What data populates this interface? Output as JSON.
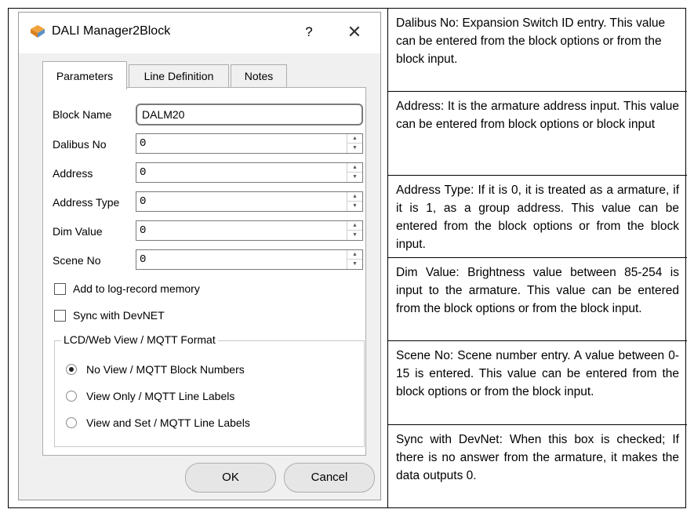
{
  "dialog": {
    "title": "DALI Manager2Block",
    "help_label": "?",
    "close_label": "✕",
    "tabs": [
      {
        "label": "Parameters"
      },
      {
        "label": "Line Definition"
      },
      {
        "label": "Notes"
      }
    ],
    "fields": [
      {
        "label": "Block Name",
        "value": "DALM20"
      },
      {
        "label": "Dalibus No",
        "value": "0"
      },
      {
        "label": "Address",
        "value": "0"
      },
      {
        "label": "Address Type",
        "value": "0"
      },
      {
        "label": "Dim Value",
        "value": "0"
      },
      {
        "label": "Scene No",
        "value": "0"
      }
    ],
    "checkboxes": [
      {
        "label": "Add to log-record memory",
        "checked": false
      },
      {
        "label": "Sync with DevNET",
        "checked": false
      }
    ],
    "format_group": {
      "title": "LCD/Web View / MQTT Format",
      "options": [
        {
          "label": "No View / MQTT Block Numbers",
          "selected": true
        },
        {
          "label": "View Only / MQTT Line Labels",
          "selected": false
        },
        {
          "label": "View and Set / MQTT Line Labels",
          "selected": false
        }
      ]
    },
    "ok_label": "OK",
    "cancel_label": "Cancel"
  },
  "descriptions": [
    "Dalibus No:  Expansion Switch ID entry. This value can be entered from the block options or from the block input.",
    "Address:  It is the armature address input. This value can be entered from block options or block input",
    "Address Type:  If it is 0, it is treated as a armature, if it is 1, as a group address. This value can be entered from the block options or from the block input.",
    "Dim Value:  Brightness value between 85-254 is input to the armature. This value can be entered from the block options or from the block input.",
    "Scene No:  Scene number entry. A value between 0-15 is entered. This value can be entered from the block options or from the block input.",
    "Sync with DevNet:  When this box is checked; If there is no answer from the armature, it makes the data outputs 0."
  ]
}
